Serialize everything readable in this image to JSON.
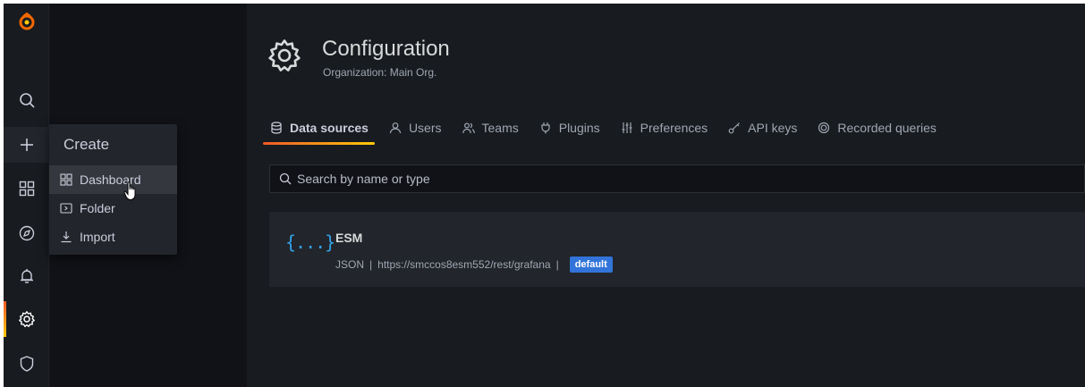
{
  "sidebar": {
    "icons": [
      "grafana-logo-icon",
      "search-icon",
      "plus-icon",
      "dashboards-icon",
      "explore-icon",
      "alerting-icon",
      "gear-icon",
      "shield-icon"
    ],
    "active": "gear-icon"
  },
  "create_menu": {
    "title": "Create",
    "items": [
      {
        "label": "Dashboard",
        "icon": "dashboard-grid-icon"
      },
      {
        "label": "Folder",
        "icon": "folder-icon"
      },
      {
        "label": "Import",
        "icon": "import-icon"
      }
    ],
    "hovered": "Dashboard"
  },
  "header": {
    "title": "Configuration",
    "subtitle": "Organization: Main Org."
  },
  "tabs": [
    {
      "label": "Data sources",
      "icon": "database-icon",
      "active": true
    },
    {
      "label": "Users",
      "icon": "user-icon",
      "active": false
    },
    {
      "label": "Teams",
      "icon": "users-icon",
      "active": false
    },
    {
      "label": "Plugins",
      "icon": "plug-icon",
      "active": false
    },
    {
      "label": "Preferences",
      "icon": "sliders-icon",
      "active": false
    },
    {
      "label": "API keys",
      "icon": "key-icon",
      "active": false
    },
    {
      "label": "Recorded queries",
      "icon": "record-icon",
      "active": false
    }
  ],
  "search": {
    "placeholder": "Search by name or type",
    "value": ""
  },
  "datasource": {
    "icon_text": "{...}",
    "name": "ESM",
    "type": "JSON",
    "separator": "|",
    "url": "https://smccos8esm552/rest/grafana",
    "badge": "default"
  },
  "colors": {
    "background": "#111217",
    "panel": "#181b1f",
    "card": "#22252b",
    "accent_start": "#f05a28",
    "accent_end": "#fbca0a",
    "link_blue": "#33a2e5",
    "badge_blue": "#3274d9"
  }
}
